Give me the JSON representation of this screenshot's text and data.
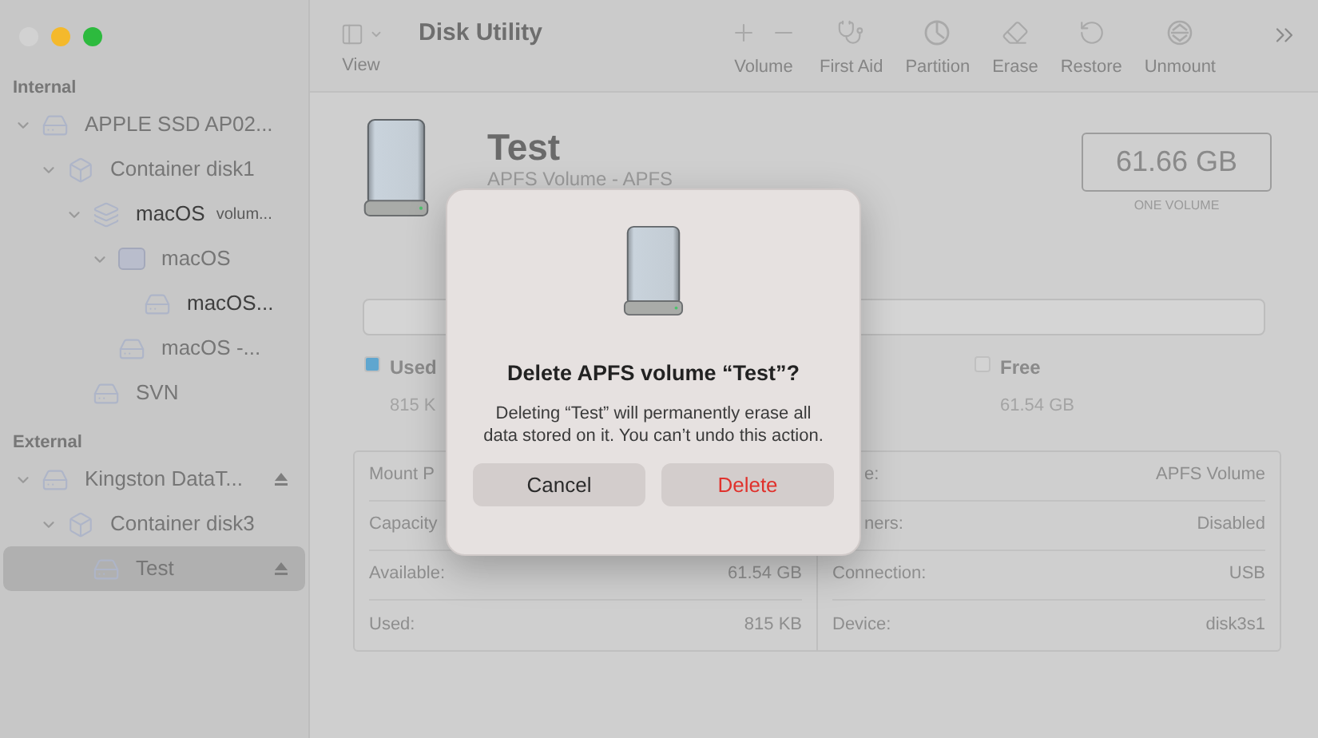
{
  "window": {
    "title": "Disk Utility",
    "controls": [
      {
        "color": "#d2d2d2"
      },
      {
        "color": "#f4b92c"
      },
      {
        "color": "#2dba3e"
      }
    ]
  },
  "toolbar": {
    "view_label": "View",
    "actions": [
      {
        "kind": "volume",
        "label": "Volume"
      },
      {
        "kind": "first-aid",
        "label": "First Aid"
      },
      {
        "kind": "partition",
        "label": "Partition"
      },
      {
        "kind": "erase",
        "label": "Erase"
      },
      {
        "kind": "restore",
        "label": "Restore"
      },
      {
        "kind": "unmount",
        "label": "Unmount"
      }
    ]
  },
  "sidebar": {
    "sections": [
      {
        "heading": "Internal",
        "items": [
          {
            "kind": "disk",
            "name": "APPLE SSD AP02...",
            "mounted": false,
            "selected": false,
            "expanded": true,
            "ejectable": false,
            "children": [
              {
                "kind": "container",
                "name": "Container disk1",
                "mounted": false,
                "selected": false,
                "expanded": true,
                "ejectable": false,
                "children": [
                  {
                    "kind": "stack",
                    "name": "macOS",
                    "note": "volum...",
                    "mounted": true,
                    "selected": false,
                    "expanded": true,
                    "ejectable": false,
                    "children": [
                      {
                        "kind": "blank",
                        "name": "macOS",
                        "mounted": false,
                        "selected": false,
                        "expanded": true,
                        "ejectable": false,
                        "children": [
                          {
                            "kind": "volume",
                            "name": "macOS...",
                            "mounted": true,
                            "selected": false,
                            "ejectable": false
                          }
                        ]
                      },
                      {
                        "kind": "volume",
                        "name": "macOS -...",
                        "mounted": false,
                        "selected": false,
                        "ejectable": false
                      }
                    ]
                  },
                  {
                    "kind": "volume",
                    "name": "SVN",
                    "mounted": false,
                    "selected": false,
                    "ejectable": false
                  }
                ]
              }
            ]
          }
        ]
      },
      {
        "heading": "External",
        "items": [
          {
            "kind": "disk",
            "name": "Kingston DataT...",
            "mounted": false,
            "selected": false,
            "expanded": true,
            "ejectable": true,
            "children": [
              {
                "kind": "container",
                "name": "Container disk3",
                "mounted": false,
                "selected": false,
                "expanded": true,
                "ejectable": false,
                "children": [
                  {
                    "kind": "volume",
                    "name": "Test",
                    "mounted": false,
                    "selected": true,
                    "ejectable": true
                  }
                ]
              }
            ]
          }
        ]
      }
    ]
  },
  "volume": {
    "name": "Test",
    "subtitle": "APFS Volume - APFS",
    "size": "61.66 GB",
    "size_caption": "ONE VOLUME"
  },
  "usage": {
    "legend": [
      {
        "label": "Used",
        "value": "815 K",
        "color": "#5fa6cf"
      },
      {
        "label": "Free",
        "value": "61.54 GB",
        "color": "#d3d3d3"
      }
    ]
  },
  "info": {
    "columns": [
      [
        {
          "label": "Mount P",
          "clipped": false
        },
        {
          "label": "Capacity",
          "clipped": false
        },
        {
          "label": "Available:",
          "value": "61.54 GB",
          "clipped": false
        },
        {
          "label": "Used:",
          "value": "815 KB",
          "clipped": false
        }
      ],
      [
        {
          "label": "e:",
          "value": "APFS Volume",
          "clipped": true
        },
        {
          "label": "ners:",
          "value": "Disabled",
          "clipped": true
        },
        {
          "label": "Connection:",
          "value": "USB",
          "clipped": false
        },
        {
          "label": "Device:",
          "value": "disk3s1",
          "clipped": false
        }
      ]
    ]
  },
  "dialog": {
    "title": "Delete APFS volume “Test”?",
    "message": "Deleting “Test” will permanently erase all data stored on it. You can’t undo this action.",
    "buttons": [
      {
        "label": "Cancel",
        "kind": "normal"
      },
      {
        "label": "Delete",
        "kind": "destructive"
      }
    ]
  }
}
